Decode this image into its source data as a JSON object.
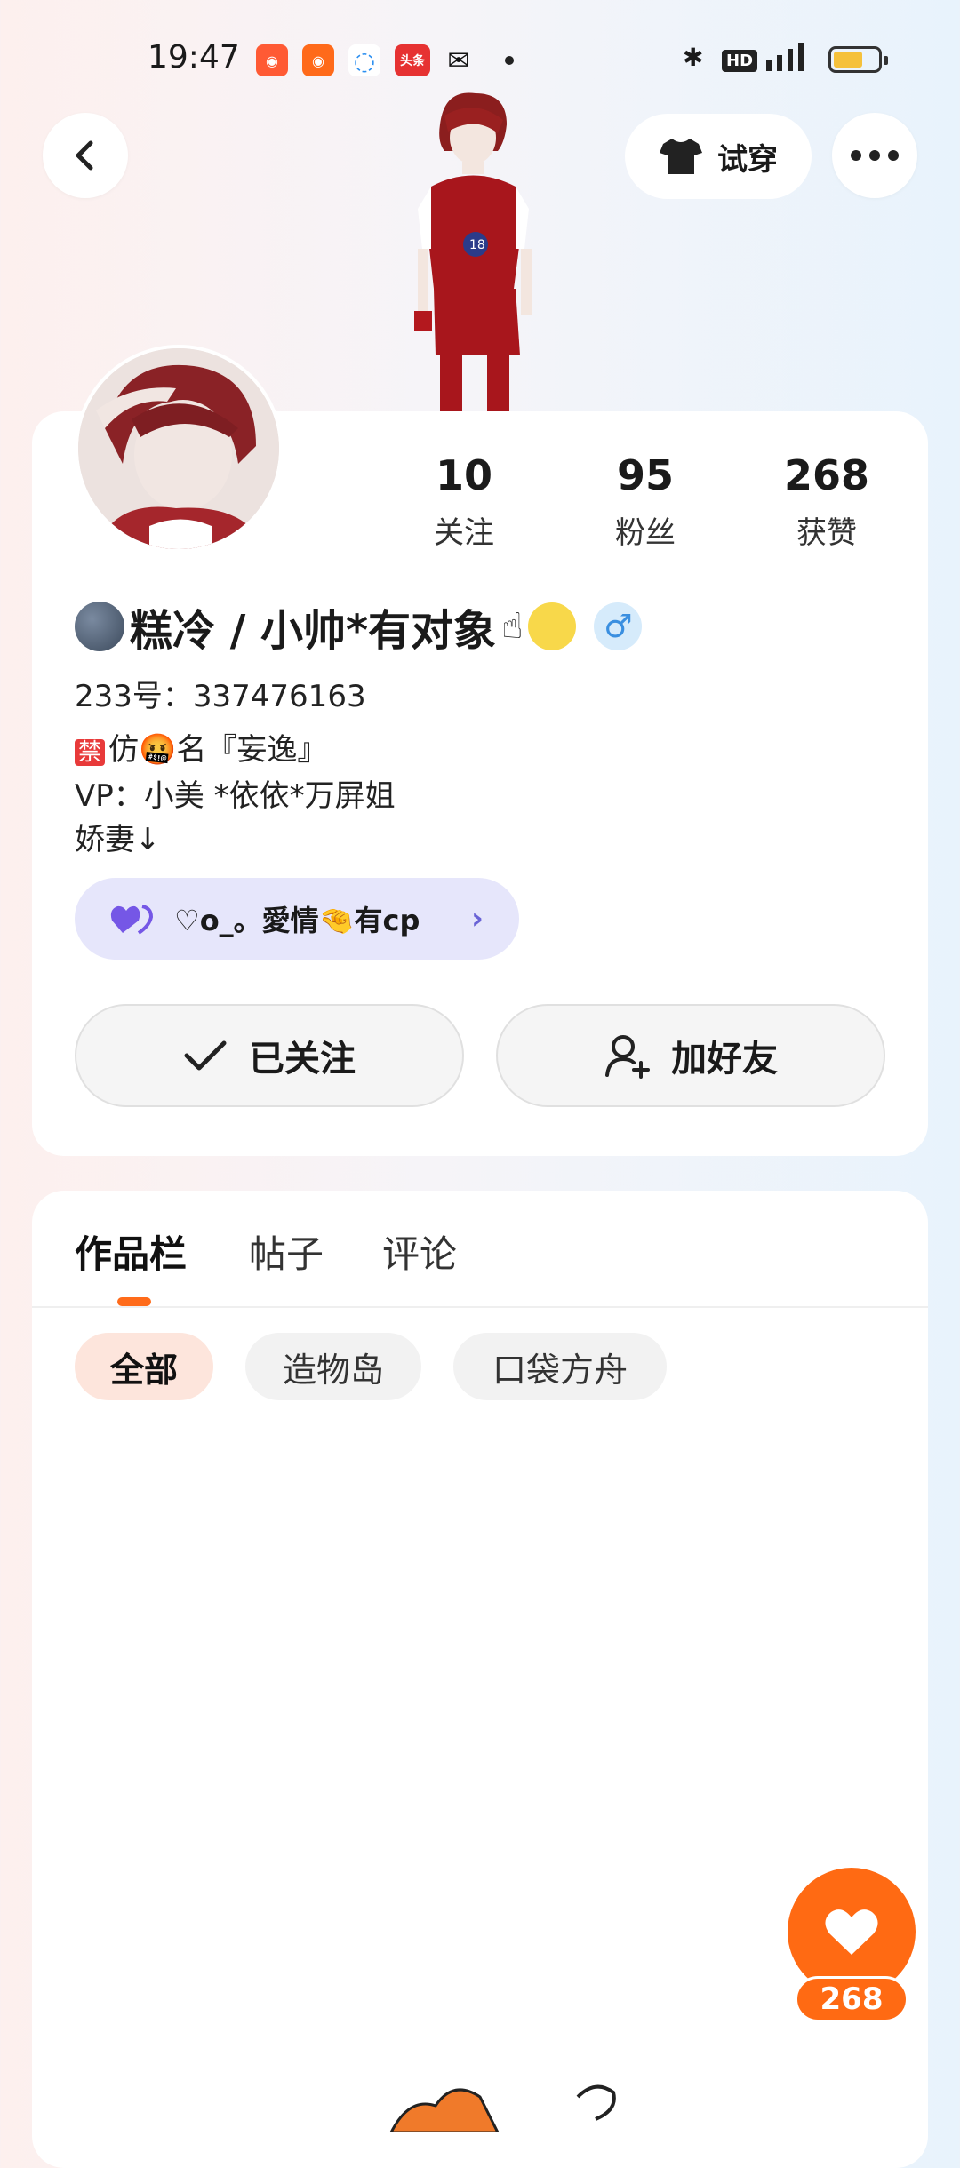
{
  "status_bar": {
    "time": "19:47",
    "icons": [
      "kuaishou-icon",
      "kuaishou-icon",
      "browser-icon",
      "toutiao-icon",
      "wechat-icon"
    ],
    "toutiao_label": "头条"
  },
  "header": {
    "try_on_label": "试穿"
  },
  "profile": {
    "stats": [
      {
        "value": "10",
        "label": "关注"
      },
      {
        "value": "95",
        "label": "粉丝"
      },
      {
        "value": "268",
        "label": "获赞"
      }
    ],
    "nickname": "糕冷 / 小帅*有对象",
    "uid": "233号：337476163",
    "bio_line1_rest": "仿🤬名『妄逸』",
    "bio_ban": "禁",
    "bio_line2": "VP：小美 *依依*万屏姐",
    "bio_line3": "娇妻↓",
    "cp_text": "♡o_。愛情🤏有cp",
    "follow_label": "已关注",
    "add_friend_label": "加好友"
  },
  "tabs": [
    "作品栏",
    "帖子",
    "评论"
  ],
  "filters": [
    "全部",
    "造物岛",
    "口袋方舟"
  ],
  "like_count": "268",
  "colors": {
    "accent": "#ff6a13",
    "chip_active": "#fde5dc",
    "cp_bg": "#e6e6fb"
  }
}
